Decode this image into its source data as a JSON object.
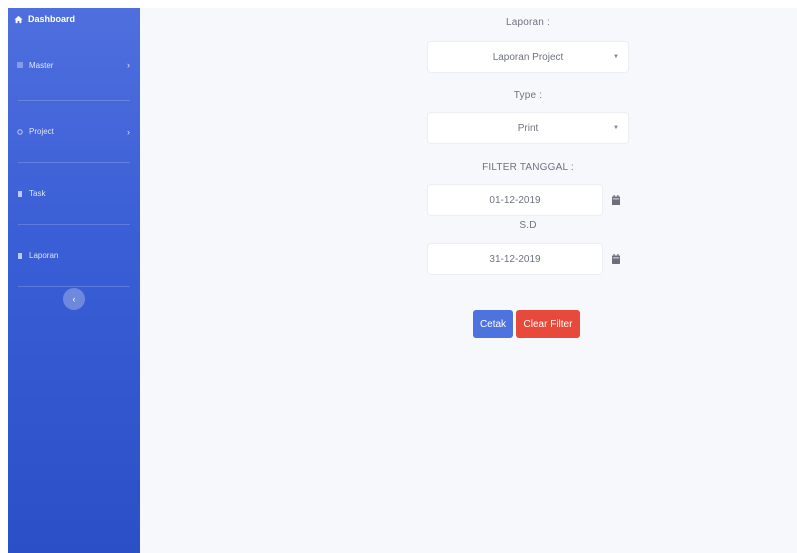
{
  "sidebar": {
    "brand": "Dashboard",
    "items": [
      {
        "label": "Master",
        "has_chevron": true
      },
      {
        "label": "Project",
        "has_chevron": true
      },
      {
        "label": "Task",
        "has_chevron": false
      },
      {
        "label": "Laporan",
        "has_chevron": false
      }
    ],
    "chevron_glyph": "›",
    "toggle_glyph": "‹"
  },
  "form": {
    "laporan_label": "Laporan :",
    "laporan_value": "Laporan Project",
    "type_label": "Type :",
    "type_value": "Print",
    "filter_label": "FILTER TANGGAL :",
    "date_from": "01-12-2019",
    "sd_label": "S.D",
    "date_to": "31-12-2019",
    "select_arrow": "▼"
  },
  "buttons": {
    "cetak": "Cetak",
    "clear_filter": "Clear Filter"
  },
  "colors": {
    "sidebar_top": "#4f6fde",
    "sidebar_bottom": "#2b4fc6",
    "primary": "#4e73df",
    "danger": "#e74a3b",
    "background": "#f7f8fc"
  },
  "icons": {
    "brand": "home-icon",
    "master": "list-icon",
    "project": "settings-icon",
    "task": "task-icon",
    "laporan": "report-icon",
    "date": "calendar-icon"
  }
}
